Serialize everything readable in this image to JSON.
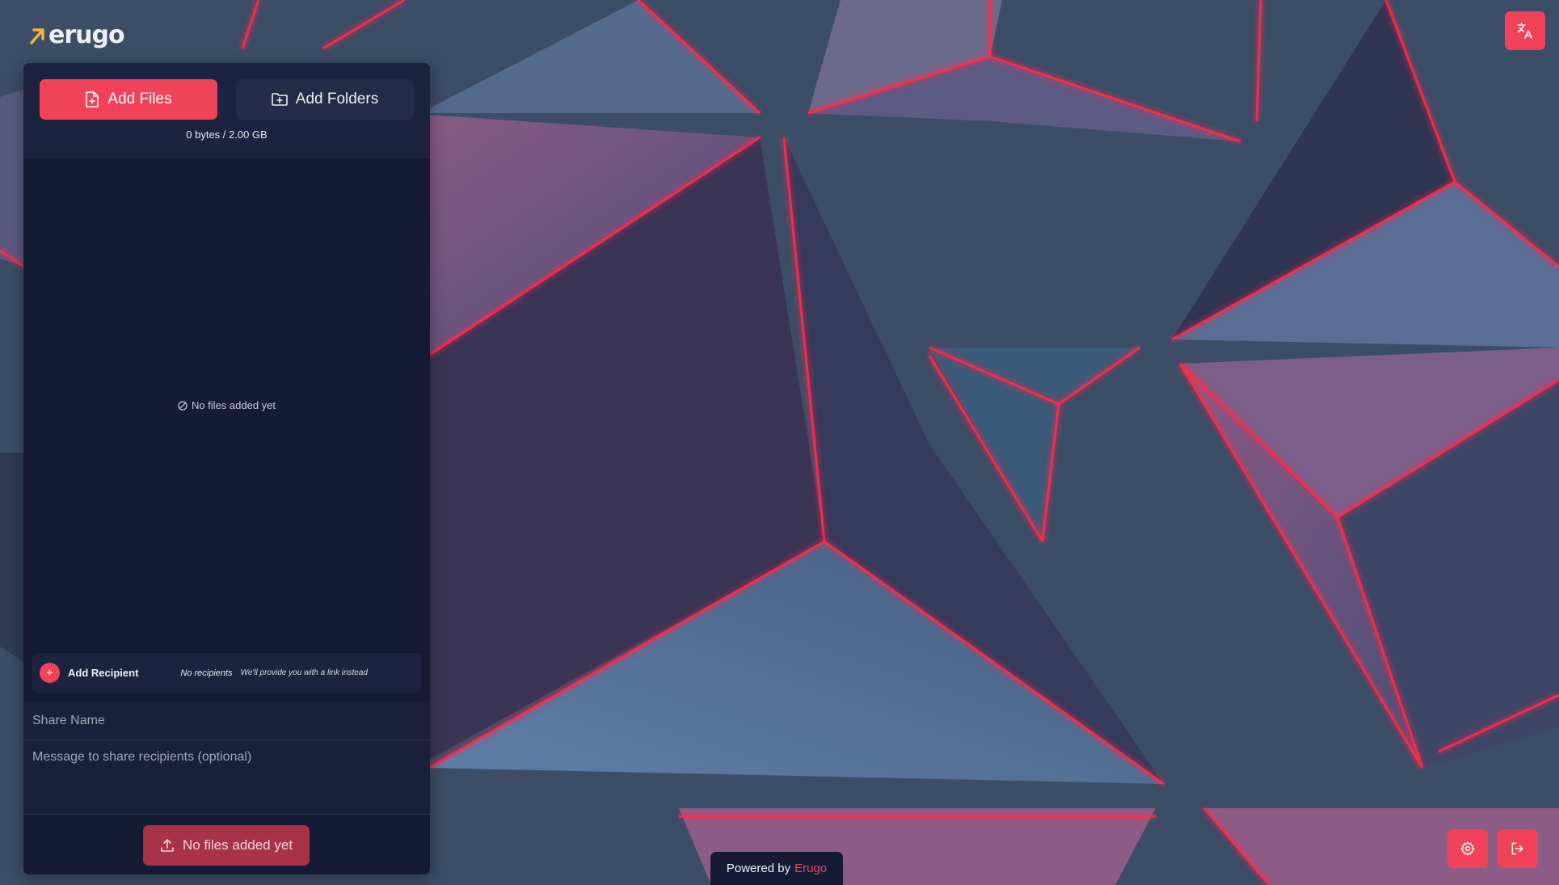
{
  "app": {
    "logo_text": "erugo",
    "colors": {
      "accent": "#f0435a",
      "panel": "#161b35",
      "logo_arrow": "#f2b632"
    }
  },
  "toolbar": {
    "add_files_label": "Add Files",
    "add_files_icon": "file-plus-icon",
    "add_folders_label": "Add Folders",
    "add_folders_icon": "folder-plus-icon"
  },
  "storage": {
    "usage_text": "0 bytes / 2.00 GB"
  },
  "files": {
    "empty_text": "No files added yet",
    "empty_icon": "slash-circle-icon"
  },
  "recipients": {
    "add_label": "Add Recipient",
    "none_text": "No recipients",
    "link_note": "We'll provide you with a link instead"
  },
  "form": {
    "share_name_placeholder": "Share Name",
    "message_placeholder": "Message to share recipients (optional)"
  },
  "upload": {
    "label": "No files added yet",
    "icon": "upload-icon"
  },
  "footer": {
    "powered_prefix": "Powered by",
    "powered_brand": "Erugo"
  },
  "actions": {
    "translate_icon": "translate-icon",
    "settings_icon": "gear-icon",
    "logout_icon": "logout-icon"
  }
}
